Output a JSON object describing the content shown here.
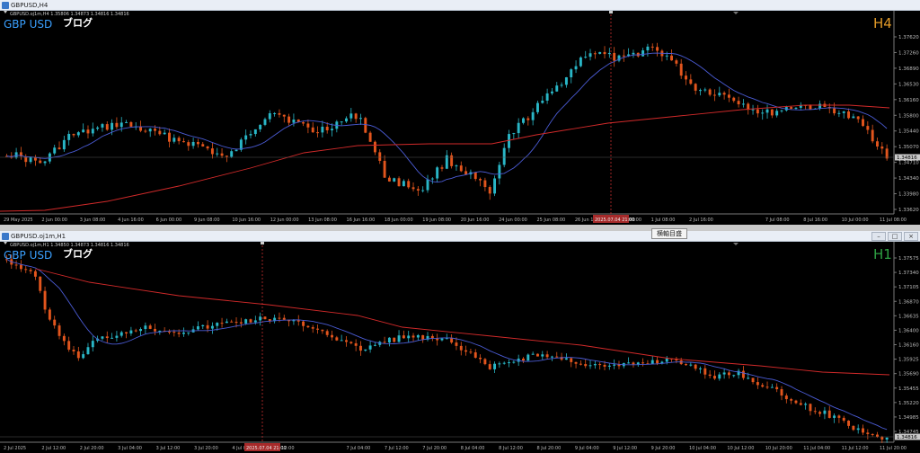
{
  "float_button": "横軸目盛",
  "windows": [
    {
      "titlebar": "GBPUSD,H4",
      "info": "GBPUSD.oj1m,H4  1.35806 1.34873 1.34816 1.34816",
      "symbol": "GBP USD",
      "blog": "ブログ",
      "tf": "H4",
      "tf_color": "#e39b28",
      "current_price": "1.34816",
      "price_labels": [
        "1.37620",
        "1.37260",
        "1.36890",
        "1.36530",
        "1.36160",
        "1.35800",
        "1.35440",
        "1.35070",
        "1.34710",
        "1.34340",
        "1.33980",
        "1.33620"
      ],
      "date_labels": [
        "29 May 2025",
        "2 Jun 00:00",
        "3 Jun 08:00",
        "4 Jun 16:00",
        "6 Jun 00:00",
        "9 Jun 08:00",
        "10 Jun 16:00",
        "12 Jun 00:00",
        "13 Jun 08:00",
        "16 Jun 16:00",
        "18 Jun 00:00",
        "19 Jun 08:00",
        "20 Jun 16:00",
        "24 Jun 00:00",
        "25 Jun 08:00",
        "26 Jun 16:00",
        "30 Jun 00:00",
        "1 Jul 08:00",
        "2 Jul 16:00",
        "",
        "7 Jul 08:00",
        "8 Jul 16:00",
        "10 Jul 00:00",
        "11 Jul 08:00"
      ],
      "cursor_date": "2025.07.04 21:00",
      "candle_colors": {
        "up": "#29b6c6",
        "down": "#e2551d"
      }
    },
    {
      "titlebar": "GBPUSD.oj1m,H1",
      "info": "GBPUSD.oj1m,H1  1.34850 1.34873 1.34816 1.34816",
      "symbol": "GBP USD",
      "blog": "ブログ",
      "tf": "H1",
      "tf_color": "#2ea043",
      "current_price": "1.34816",
      "price_labels": [
        "1.37575",
        "1.37340",
        "1.37105",
        "1.36870",
        "1.36635",
        "1.36400",
        "1.36160",
        "1.35925",
        "1.35690",
        "1.35455",
        "1.35220",
        "1.34985",
        "1.34745"
      ],
      "date_labels": [
        "2 Jul 2025",
        "2 Jul 12:00",
        "2 Jul 20:00",
        "3 Jul 04:00",
        "3 Jul 12:00",
        "3 Jul 20:00",
        "4 Jul 04:00",
        "4 Jul 12:00",
        "",
        "7 Jul 04:00",
        "7 Jul 12:00",
        "7 Jul 20:00",
        "8 Jul 04:00",
        "8 Jul 12:00",
        "8 Jul 20:00",
        "9 Jul 04:00",
        "9 Jul 12:00",
        "9 Jul 20:00",
        "10 Jul 04:00",
        "10 Jul 12:00",
        "10 Jul 20:00",
        "11 Jul 04:00",
        "11 Jul 12:00",
        "11 Jul 20:00"
      ],
      "cursor_date": "2025.07.04 21:00",
      "candle_colors": {
        "up": "#29b6c6",
        "down": "#e2551d"
      }
    }
  ]
}
